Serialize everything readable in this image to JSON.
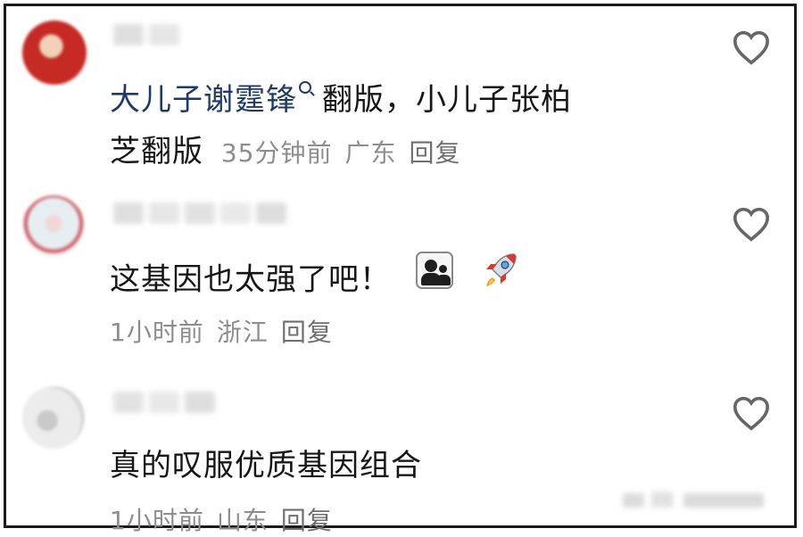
{
  "comments": [
    {
      "mention": "大儿子谢霆锋",
      "text_line1": "翻版，小儿子张柏",
      "text_line2": "芝翻版",
      "time": "35分钟前",
      "location": "广东",
      "reply_label": "回复",
      "like_icon": "heart-outline-icon"
    },
    {
      "text": "这基因也太强了吧！",
      "emojis": [
        "busts-in-silhouette-icon",
        "rocket-icon"
      ],
      "time": "1小时前",
      "location": "浙江",
      "reply_label": "回复",
      "like_icon": "heart-outline-icon"
    },
    {
      "text": "真的叹服优质基因组合",
      "time": "1小时前",
      "location": "山东",
      "reply_label": "回复",
      "like_icon": "heart-outline-icon"
    }
  ],
  "colors": {
    "mention": "#1e3b67",
    "text": "#161616",
    "meta": "#8d8d8d",
    "heart": "#666666"
  }
}
